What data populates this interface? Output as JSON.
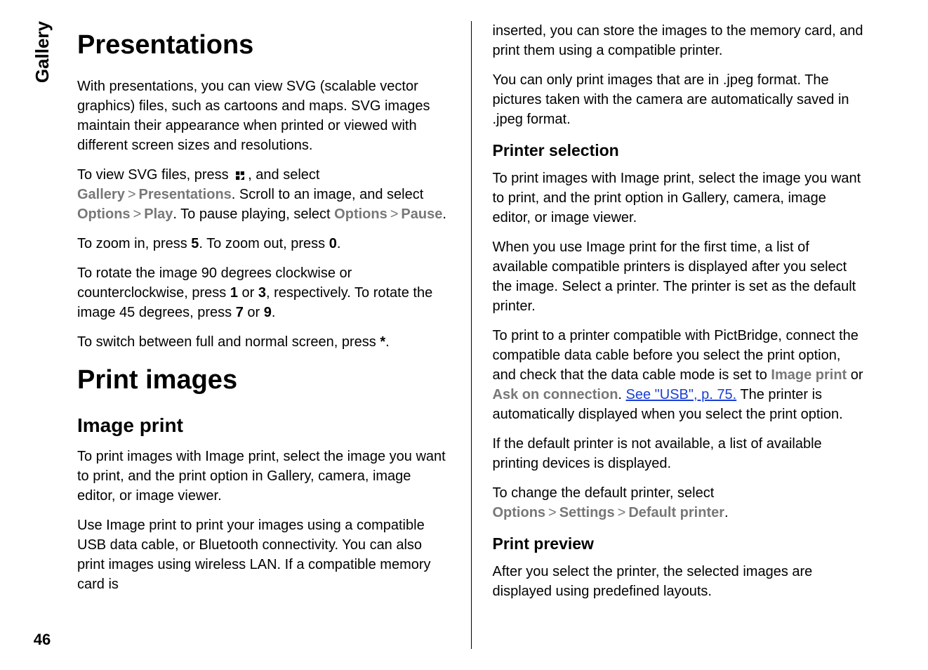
{
  "sidebar": {
    "section_label": "Gallery",
    "page_number": "46"
  },
  "left": {
    "h1_presentations": "Presentations",
    "p1": "With presentations, you can view SVG (scalable vector graphics) files, such as cartoons and maps. SVG images maintain their appearance when printed or viewed with different screen sizes and resolutions.",
    "p2a": "To view SVG files, press ",
    "p2b": ", and select ",
    "gallery": "Gallery",
    "presentations": "Presentations",
    "p2c": ". Scroll to an image, and select ",
    "options1": "Options",
    "play": "Play",
    "p2d": ". To pause playing, select ",
    "options2": "Options",
    "pause": "Pause",
    "p3a": "To zoom in, press ",
    "key5": "5",
    "p3b": ". To zoom out, press ",
    "key0": "0",
    "p4a": "To rotate the image 90 degrees clockwise or counterclockwise, press ",
    "key1": "1",
    "or1": " or ",
    "key3": "3",
    "p4b": ", respectively. To rotate the image 45 degrees, press ",
    "key7": "7",
    "or2": " or ",
    "key9": "9",
    "p5a": "To switch between full and normal screen, press ",
    "keystar": "*",
    "h1_print": "Print images",
    "h2_imageprint": "Image print",
    "p6": "To print images with Image print, select the image you want to print, and the print option in Gallery, camera, image editor, or image viewer.",
    "p7": "Use Image print to print your images using a compatible USB data cable, or Bluetooth connectivity. You can also print images using wireless LAN. If a compatible memory card is"
  },
  "right": {
    "p1": "inserted, you can store the images to the memory card, and print them using a compatible printer.",
    "p2": "You can only print images that are in .jpeg format. The pictures taken with the camera are automatically saved in .jpeg format.",
    "h3_printer_sel": "Printer selection",
    "p3": "To print images with Image print, select the image you want to print, and the print option in Gallery, camera, image editor, or image viewer.",
    "p4": "When you use Image print for the first time, a list of available compatible printers is displayed after you select the image. Select a printer. The printer is set as the default printer.",
    "p5a": "To print to a printer compatible with PictBridge, connect the compatible data cable before you select the print option, and check that the data cable mode is set to ",
    "image_print": "Image print",
    "or": " or ",
    "ask_on_conn": "Ask on connection",
    "dot_space": ". ",
    "link_text": "See \"USB\", p. 75.",
    "p5b": " The printer is automatically displayed when you select the print option.",
    "p6": "If the default printer is not available, a list of available printing devices is displayed.",
    "p7a": "To change the default printer, select ",
    "options": "Options",
    "settings": "Settings",
    "default_printer": "Default printer",
    "h3_print_preview": "Print preview",
    "p8": "After you select the printer, the selected images are displayed using predefined layouts."
  },
  "separators": {
    "gt": ">"
  }
}
